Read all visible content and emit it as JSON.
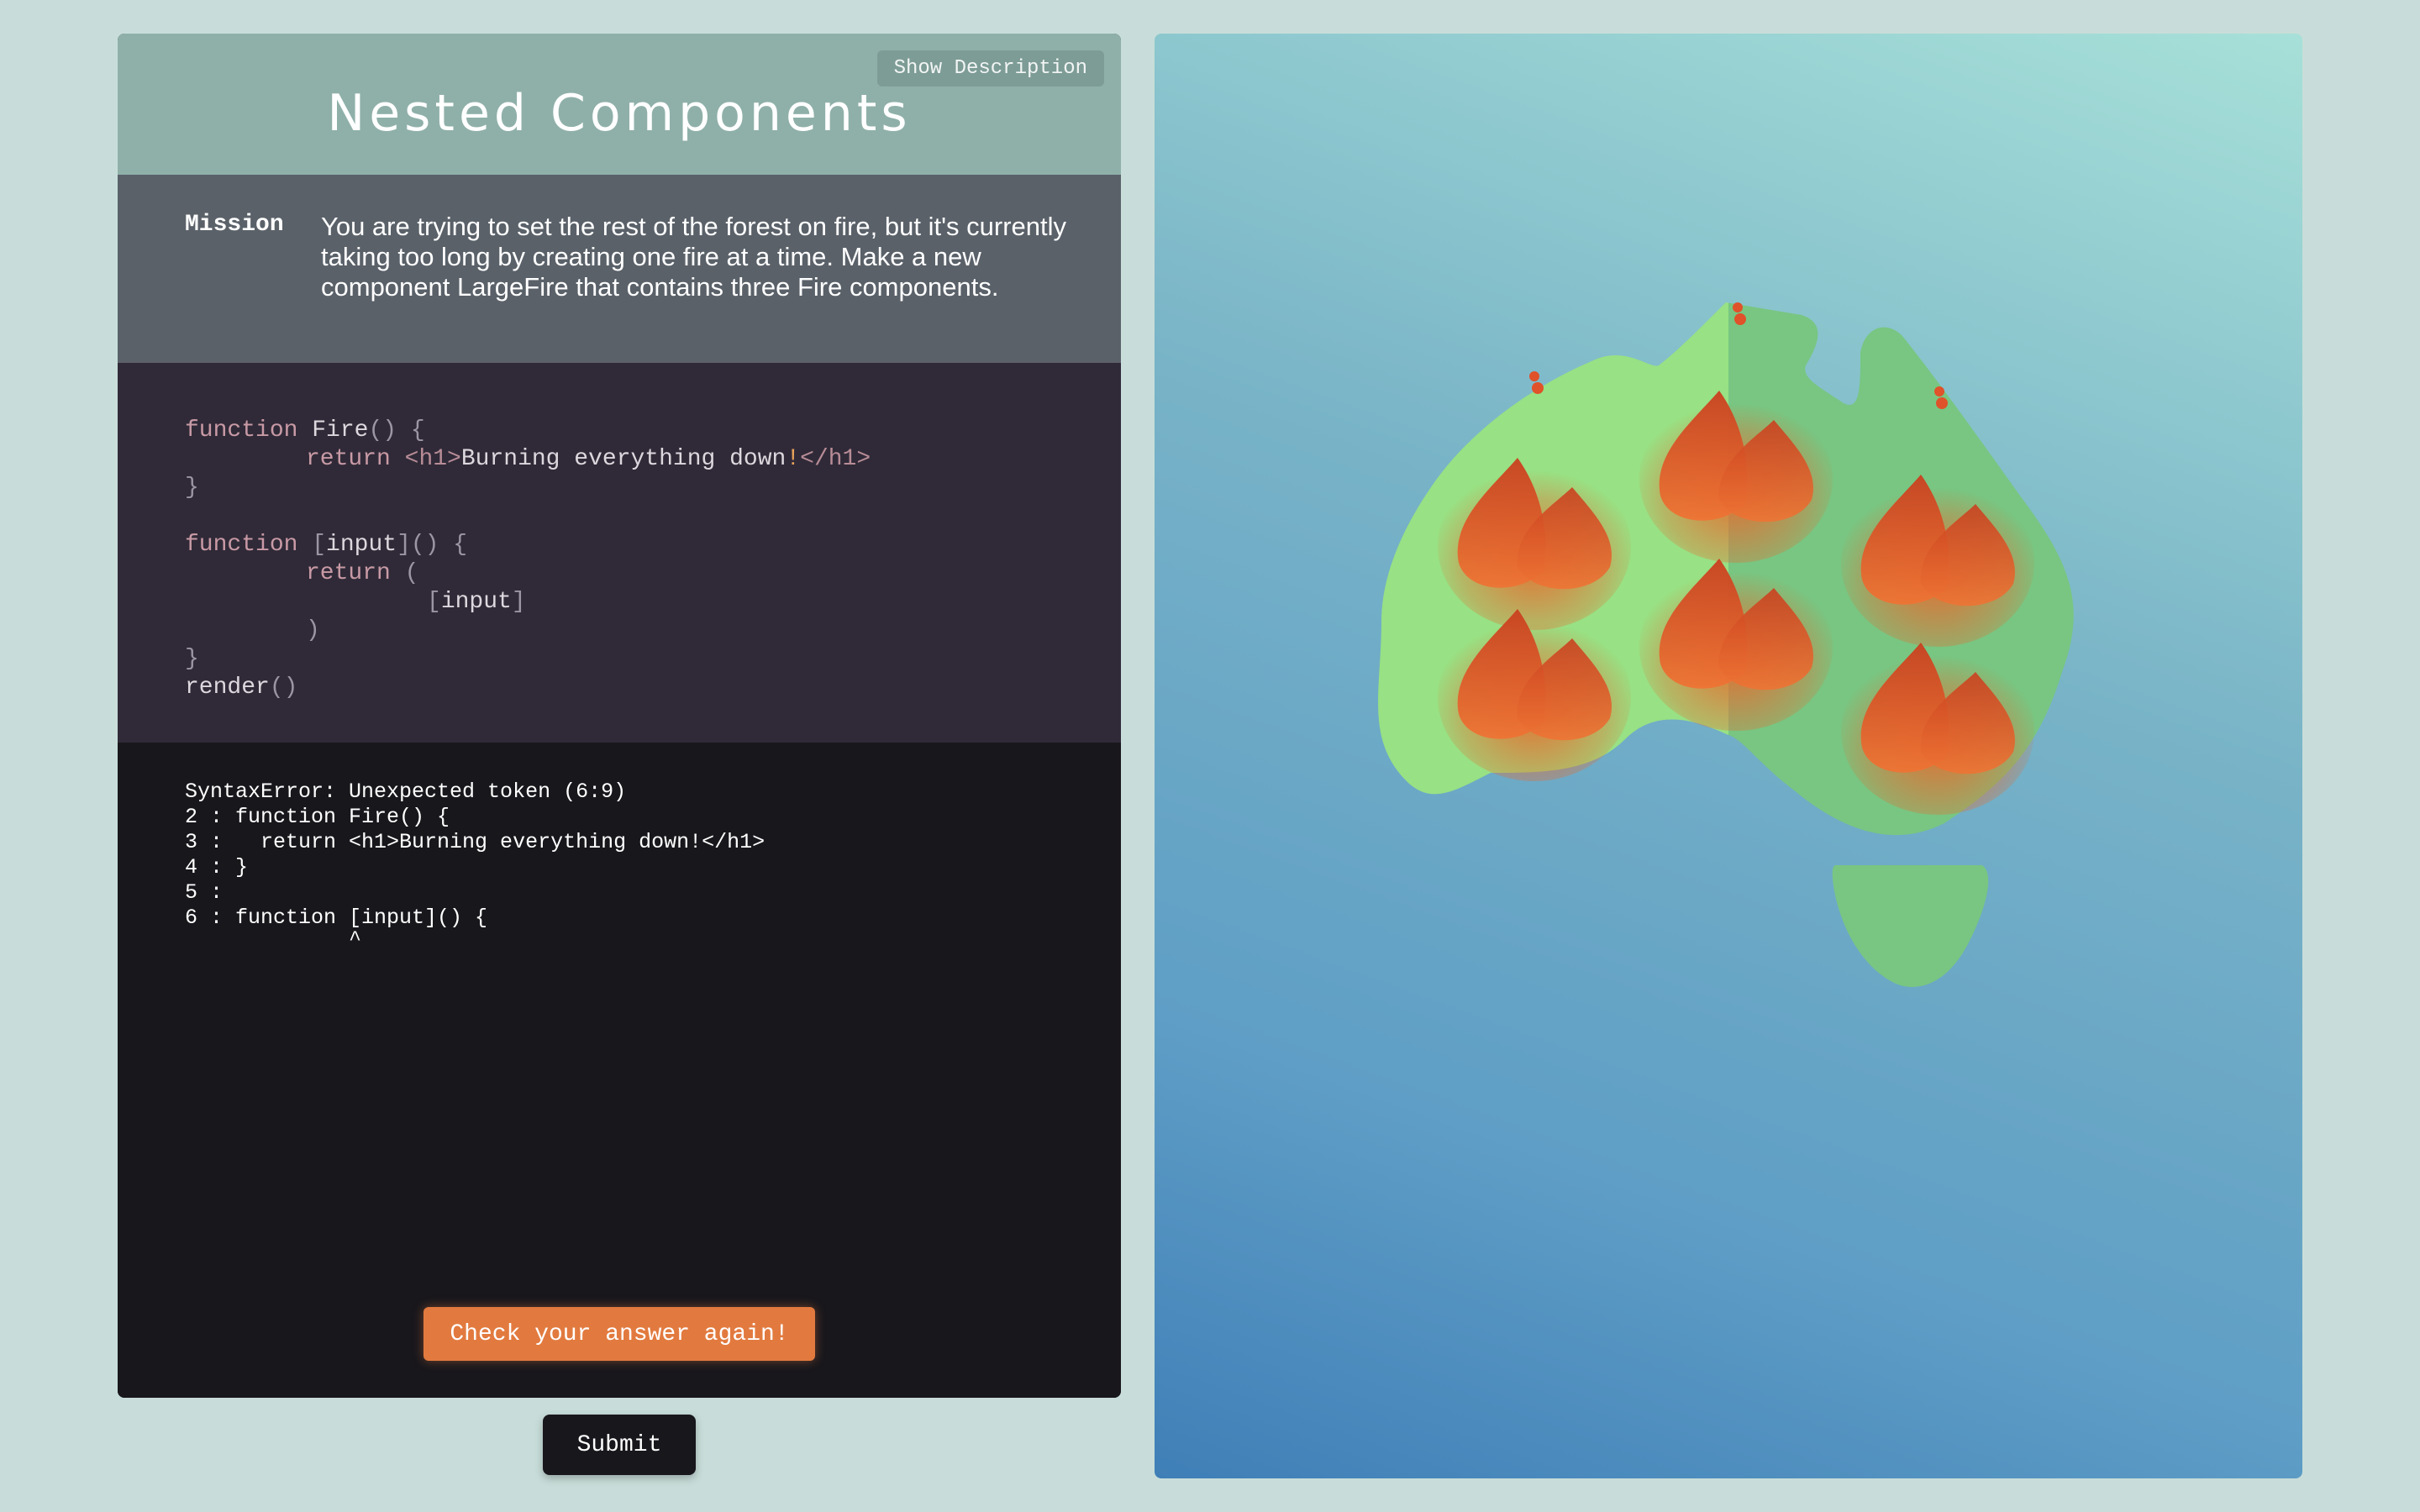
{
  "header": {
    "title": "Nested Components",
    "show_description_label": "Show Description"
  },
  "mission": {
    "label": "Mission",
    "text": "You are trying to set the rest of the forest on fire, but it's currently taking too long by creating one fire at a time. Make a new component LargeFire that contains three Fire components."
  },
  "code": {
    "l1_kw": "function",
    "l1_name": " Fire",
    "l1_rest": "() {",
    "l2_kw": "return",
    "l2_open": "<h1>",
    "l2_text": "Burning everything down",
    "l2_bang": "!",
    "l2_close": "</h1>",
    "l3": "}",
    "l5_kw": "function",
    "l5_input": "input",
    "l5_rest": "() {",
    "l6_kw": "return",
    "l6_rest": " (",
    "l7_input": "input",
    "l8": ")",
    "l9": "}",
    "l10_name": "render",
    "l10_rest": "()"
  },
  "console": {
    "lines": [
      "SyntaxError: Unexpected token (6:9)",
      "2 : function Fire() {",
      "3 :   return <h1>Burning everything down!</h1>",
      "4 : }",
      "5 :",
      "6 : function [input]() {",
      "             ^"
    ]
  },
  "buttons": {
    "check_again": "Check your answer again!",
    "submit": "Submit"
  },
  "scene": {
    "fire_count": 6,
    "colors": {
      "land_light": "#98e184",
      "land_dark": "#78c682",
      "fire": "#e9692c",
      "ember": "#e0522a"
    }
  }
}
